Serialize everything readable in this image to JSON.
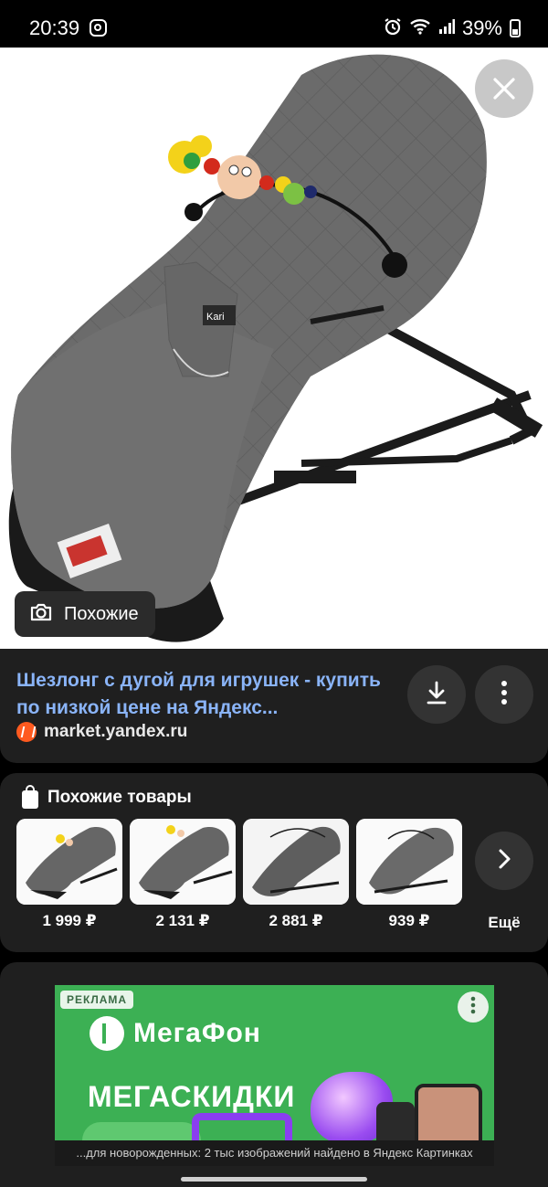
{
  "status_bar": {
    "time": "20:39",
    "battery": "39%",
    "icons": [
      "instagram-icon",
      "alarm-icon",
      "wifi-icon",
      "signal-icon",
      "battery-icon"
    ]
  },
  "viewer": {
    "image_subject": "baby-bouncer-photo",
    "similar_label": "Похожие",
    "close_icon": "close-icon"
  },
  "result": {
    "title": "Шезлонг с дугой для игрушек - купить по низкой цене на Яндекс...",
    "source": "market.yandex.ru",
    "link_color": "#8ab4f8"
  },
  "similar_products": {
    "heading": "Похожие товары",
    "items": [
      {
        "price": "1 999 ₽"
      },
      {
        "price": "2 131 ₽"
      },
      {
        "price": "2 881 ₽"
      },
      {
        "price": "939 ₽"
      }
    ],
    "more_label": "Ещё"
  },
  "ad": {
    "badge": "РЕКЛАМА",
    "brand": "МегаФон",
    "headline": "МЕГАСКИДКИ",
    "brand_color": "#3cb054"
  },
  "caption": "...для новорожденных: 2 тыс изображений найдено в Яндекс Картинках"
}
